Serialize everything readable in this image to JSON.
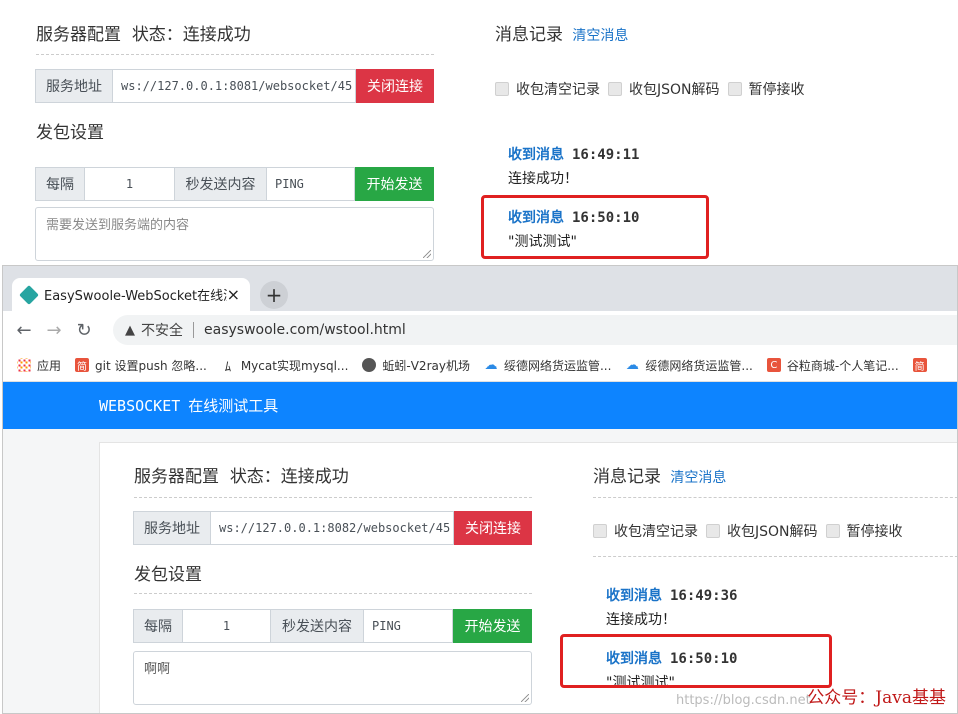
{
  "top": {
    "server_heading": "服务器配置",
    "status_text": "状态：连接成功",
    "address_label": "服务地址",
    "address_value": "ws://127.0.0.1:8081/websocket/45",
    "close_button": "关闭连接",
    "send_heading": "发包设置",
    "every_label": "每隔",
    "interval_value": "1",
    "seconds_send_label": "秒发送内容",
    "ping_value": "PING",
    "start_button": "开始发送",
    "textarea_placeholder": "需要发送到服务端的内容",
    "log_heading": "消息记录",
    "clear_link": "清空消息",
    "options": [
      "收包清空记录",
      "收包JSON解码",
      "暂停接收"
    ],
    "messages": [
      {
        "label": "收到消息",
        "time": "16:49:11",
        "body": "连接成功！"
      },
      {
        "label": "收到消息",
        "time": "16:50:10",
        "body": "\"测试测试\""
      }
    ]
  },
  "browser": {
    "tab_title": "EasySwoole-WebSocket在线测",
    "tab_close": "×",
    "new_tab": "+",
    "insecure_label": "不安全",
    "url": "easyswoole.com/wstool.html",
    "bookmarks": [
      {
        "icon": "apps-grid-icon",
        "label": "应用"
      },
      {
        "icon": "jian-icon",
        "label": "git 设置push 忽略..."
      },
      {
        "icon": "mycat-icon",
        "label": "Mycat实现mysql..."
      },
      {
        "icon": "globe-icon",
        "label": "蚯蚓-V2ray机场"
      },
      {
        "icon": "cloud-icon",
        "label": "绥德网络货运监管..."
      },
      {
        "icon": "cloud-icon",
        "label": "绥德网络货运监管..."
      },
      {
        "icon": "c-icon",
        "label": "谷粒商城-个人笔记..."
      },
      {
        "icon": "jian-icon",
        "label": "简"
      }
    ],
    "banner_mono": "WEBSOCKET",
    "banner_text": "在线测试工具"
  },
  "bottom": {
    "server_heading": "服务器配置",
    "status_text": "状态：连接成功",
    "address_label": "服务地址",
    "address_value": "ws://127.0.0.1:8082/websocket/45",
    "close_button": "关闭连接",
    "send_heading": "发包设置",
    "every_label": "每隔",
    "interval_value": "1",
    "seconds_send_label": "秒发送内容",
    "ping_value": "PING",
    "start_button": "开始发送",
    "textarea_value": "啊啊",
    "log_heading": "消息记录",
    "clear_link": "清空消息",
    "options": [
      "收包清空记录",
      "收包JSON解码",
      "暂停接收"
    ],
    "messages": [
      {
        "label": "收到消息",
        "time": "16:49:36",
        "body": "连接成功！"
      },
      {
        "label": "收到消息",
        "time": "16:50:10",
        "body": "\"测试测试\""
      }
    ]
  },
  "watermark": "公众号：Java基基",
  "faint_url": "https://blog.csdn.net",
  "colors": {
    "accent_blue": "#0d84ff",
    "danger": "#dc3545",
    "success": "#28a745",
    "highlight": "#e02020"
  }
}
